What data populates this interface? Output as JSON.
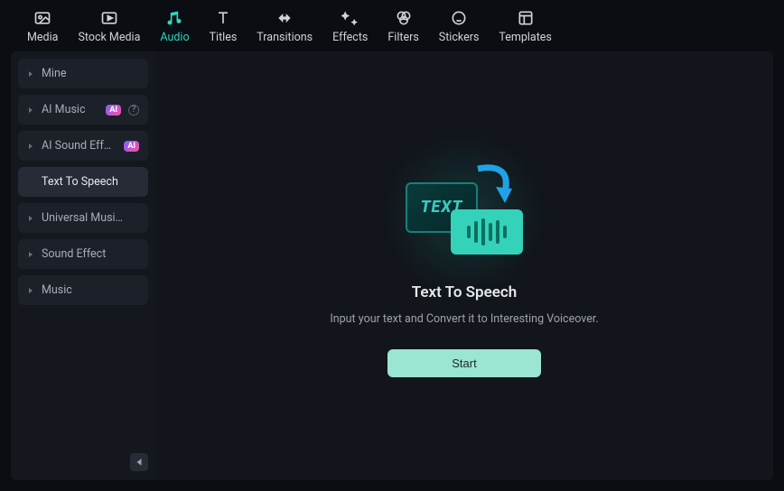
{
  "topTabs": [
    {
      "id": "media",
      "label": "Media",
      "active": false
    },
    {
      "id": "stock-media",
      "label": "Stock Media",
      "active": false
    },
    {
      "id": "audio",
      "label": "Audio",
      "active": true
    },
    {
      "id": "titles",
      "label": "Titles",
      "active": false
    },
    {
      "id": "transitions",
      "label": "Transitions",
      "active": false
    },
    {
      "id": "effects",
      "label": "Effects",
      "active": false
    },
    {
      "id": "filters",
      "label": "Filters",
      "active": false
    },
    {
      "id": "stickers",
      "label": "Stickers",
      "active": false
    },
    {
      "id": "templates",
      "label": "Templates",
      "active": false
    }
  ],
  "sidebar": {
    "items": [
      {
        "id": "mine",
        "label": "Mine",
        "active": false,
        "ai": false,
        "help": false
      },
      {
        "id": "ai-music",
        "label": "AI Music",
        "active": false,
        "ai": true,
        "help": true
      },
      {
        "id": "ai-sound-effect",
        "label": "AI Sound Effect",
        "active": false,
        "ai": true,
        "help": false
      },
      {
        "id": "text-to-speech",
        "label": "Text To Speech",
        "active": true,
        "ai": false,
        "help": false
      },
      {
        "id": "universal-music",
        "label": "Universal Musi…",
        "active": false,
        "ai": false,
        "help": false
      },
      {
        "id": "sound-effect",
        "label": "Sound Effect",
        "active": false,
        "ai": false,
        "help": false
      },
      {
        "id": "music",
        "label": "Music",
        "active": false,
        "ai": false,
        "help": false
      }
    ]
  },
  "content": {
    "illustration_text": "TEXT",
    "title": "Text To Speech",
    "subtitle": "Input your text and Convert it to Interesting Voiceover.",
    "start_label": "Start"
  },
  "badges": {
    "ai": "AI"
  }
}
